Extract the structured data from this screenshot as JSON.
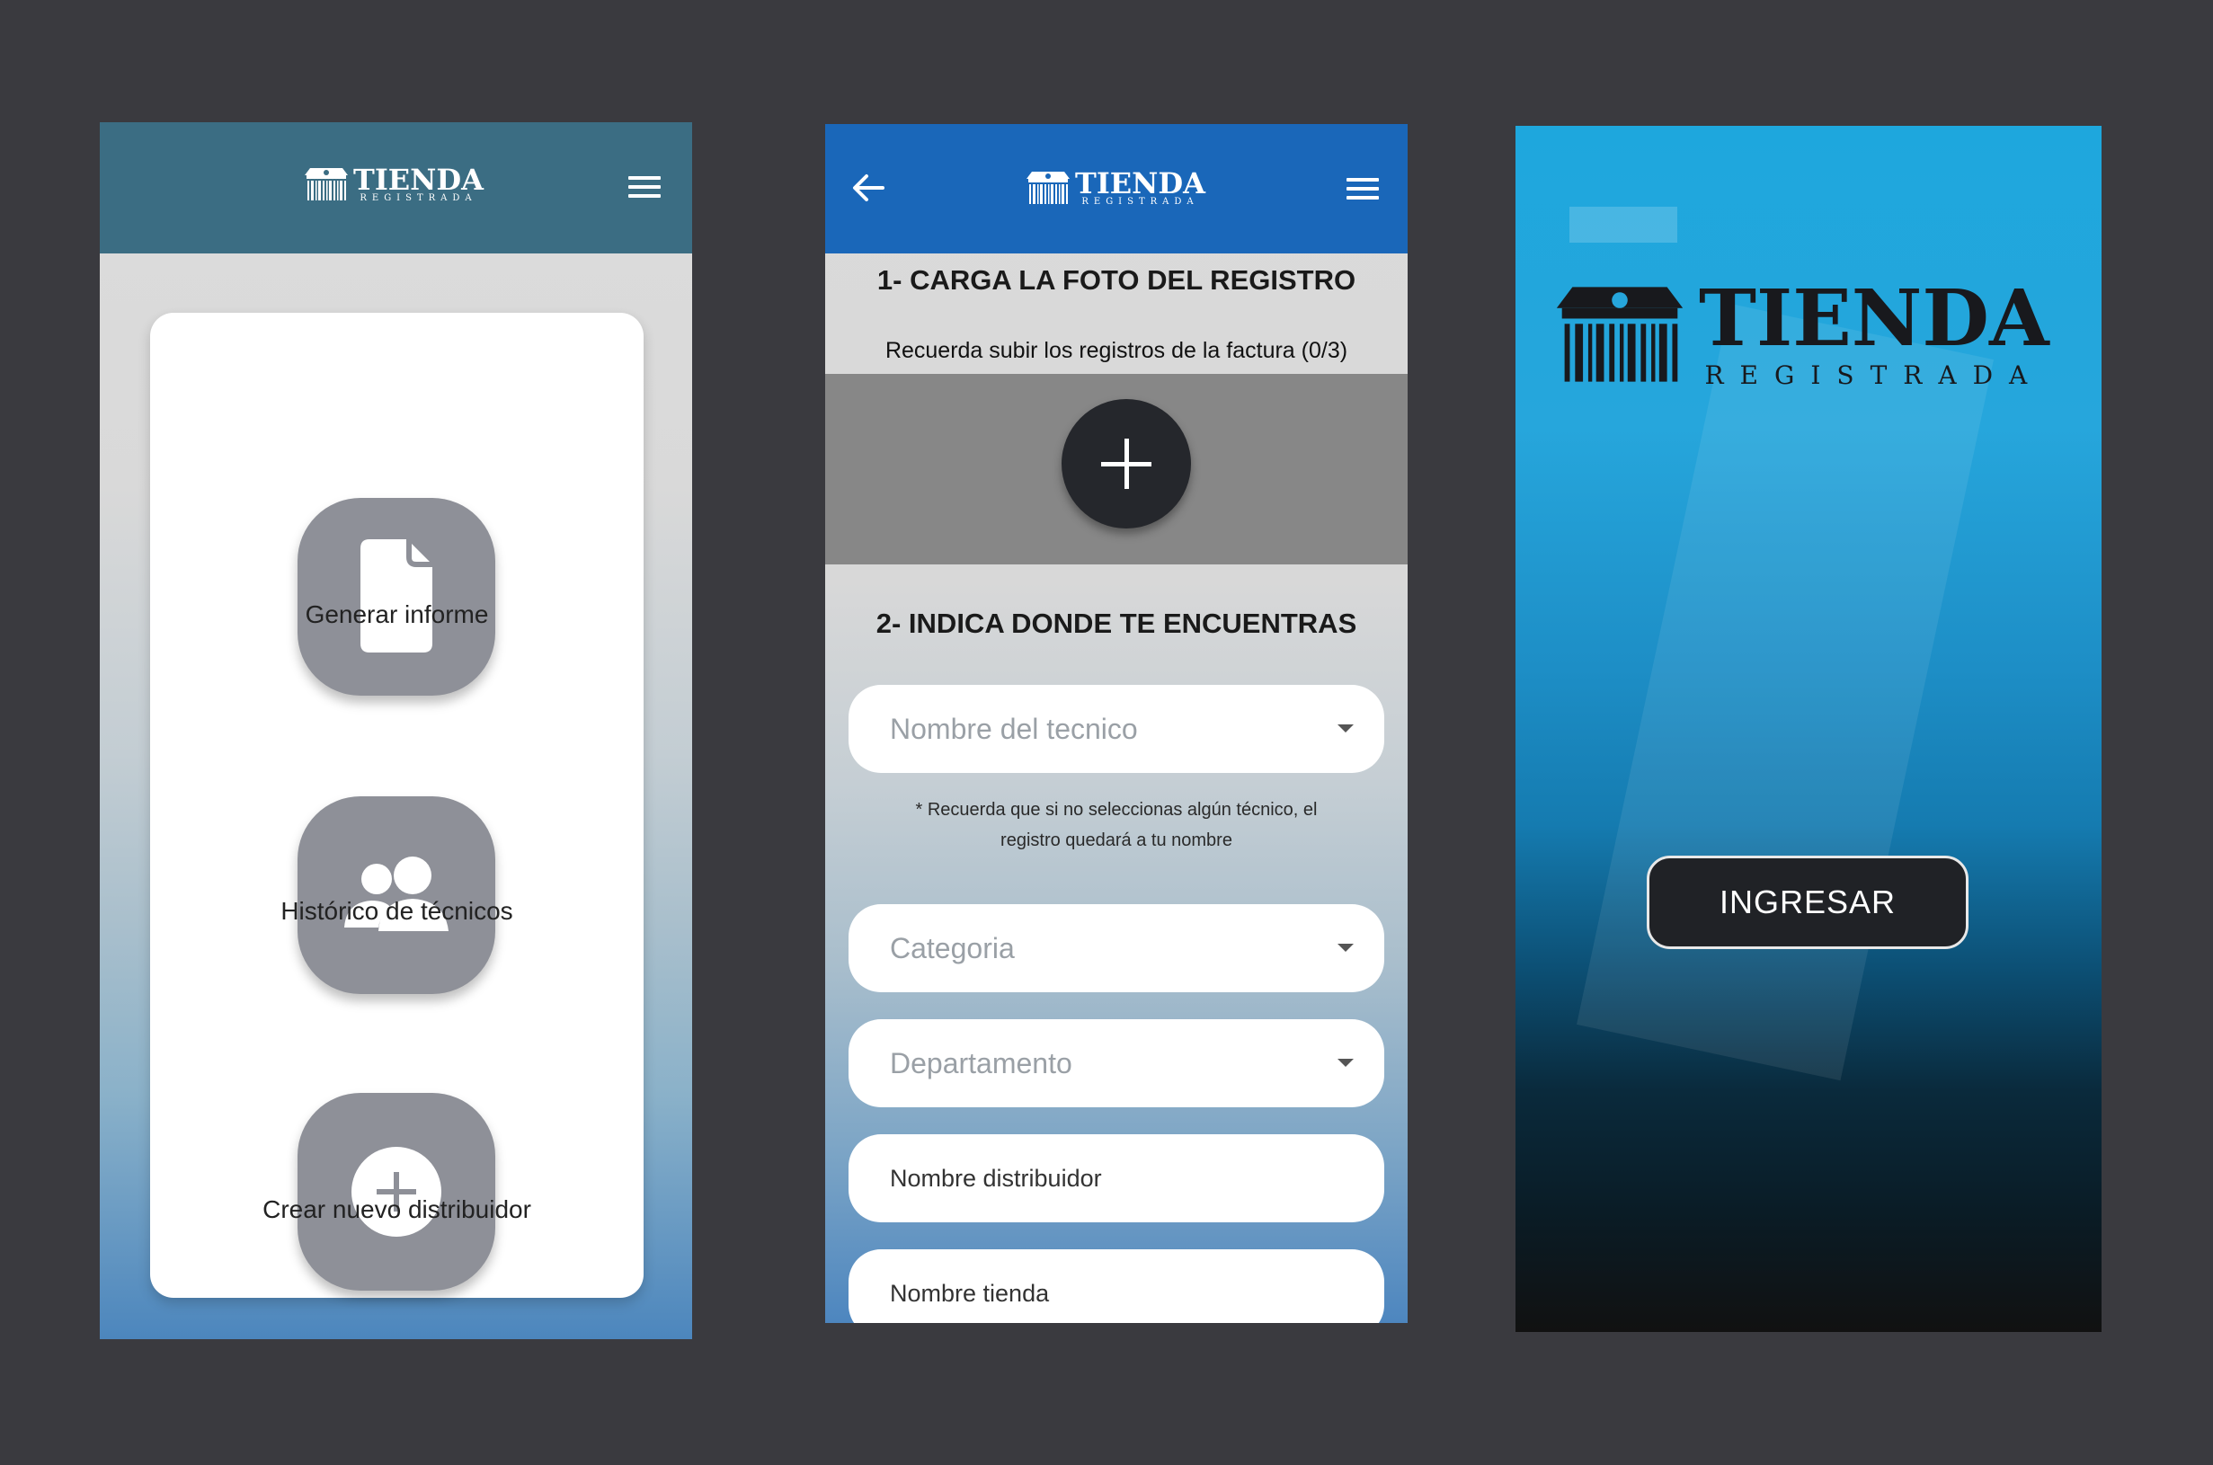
{
  "brand": {
    "word": "TIENDA",
    "sub": "REGISTRADA"
  },
  "screen_home": {
    "options": [
      {
        "label": "Generar informe",
        "icon": "document-icon"
      },
      {
        "label": "Histórico de técnicos",
        "icon": "users-icon"
      },
      {
        "label": "Crear nuevo distribuidor",
        "icon": "plus-circle-icon"
      }
    ]
  },
  "screen_form": {
    "step1_title": "1- CARGA LA FOTO DEL REGISTRO",
    "step1_hint": "Recuerda subir los registros de la factura (0/3)",
    "step2_title": "2- INDICA DONDE TE ENCUENTRAS",
    "tecnico_placeholder": "Nombre del tecnico",
    "note_line1": "* Recuerda que si no seleccionas algún técnico, el",
    "note_line2": "registro quedará a tu nombre",
    "categoria_placeholder": "Categoria",
    "departamento_placeholder": "Departamento",
    "distribuidor_label": "Nombre distribuidor",
    "tienda_label": "Nombre tienda"
  },
  "screen_login": {
    "button": "INGRESAR"
  },
  "colors": {
    "home_header": "#3b6d83",
    "form_header": "#1a67b9",
    "fab": "#25272c",
    "background": "#3a3a3f"
  }
}
